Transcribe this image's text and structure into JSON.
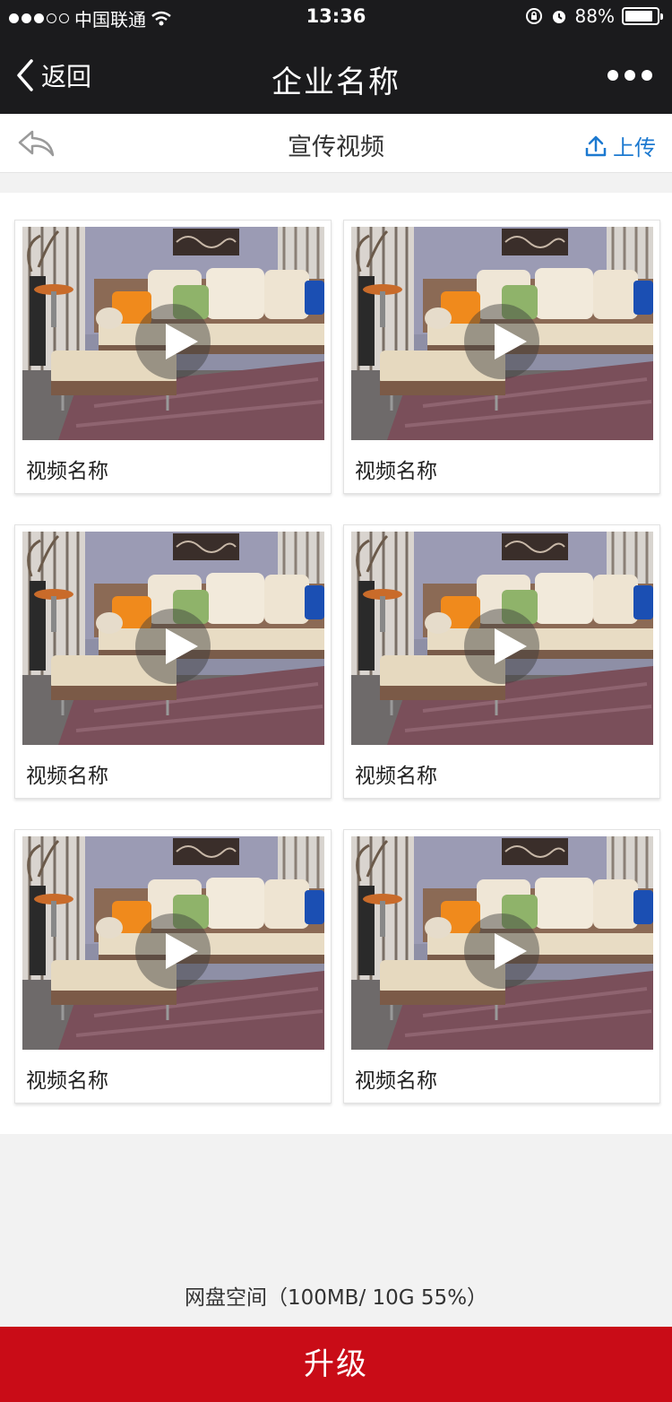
{
  "status_bar": {
    "carrier": "中国联通",
    "time": "13:36",
    "battery": "88%",
    "battery_level": 0.88
  },
  "navbar": {
    "back_label": "返回",
    "title": "企业名称",
    "more_icon": "more-dots-icon"
  },
  "subheader": {
    "back_icon": "reply-arrow-icon",
    "title": "宣传视频",
    "upload_label": "上传",
    "upload_icon": "upload-icon"
  },
  "videos": [
    {
      "name": "视频名称"
    },
    {
      "name": "视频名称"
    },
    {
      "name": "视频名称"
    },
    {
      "name": "视频名称"
    },
    {
      "name": "视频名称"
    },
    {
      "name": "视频名称"
    }
  ],
  "storage": {
    "text": "网盘空间（100MB/ 10G  55%）"
  },
  "upgrade_button": "升级",
  "colors": {
    "bar": "#1b1b1d",
    "accent_blue": "#1c79d0",
    "upgrade_red": "#c90c17"
  }
}
